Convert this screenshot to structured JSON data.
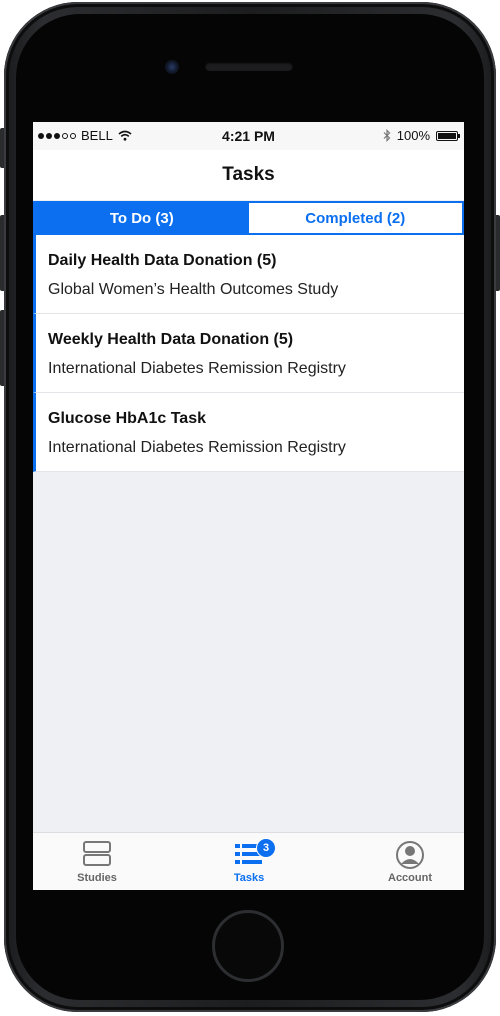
{
  "status_bar": {
    "carrier": "BELL",
    "time": "4:21 PM",
    "battery": "100%"
  },
  "nav": {
    "title": "Tasks"
  },
  "segment": {
    "todo_label": "To Do  (3)",
    "completed_label": "Completed (2)"
  },
  "tasks": [
    {
      "title": "Daily Health Data Donation (5)",
      "study": "Global Women’s Health Outcomes Study"
    },
    {
      "title": "Weekly Health Data Donation (5)",
      "study": "International Diabetes Remission Registry"
    },
    {
      "title": "Glucose HbA1c Task",
      "study": "International Diabetes Remission Registry"
    }
  ],
  "tab_bar": {
    "studies_label": "Studies",
    "tasks_label": "Tasks",
    "tasks_badge": "3",
    "account_label": "Account"
  },
  "colors": {
    "accent": "#0b6ff0",
    "background": "#eef0f3"
  },
  "icons": {
    "studies": "studies-icon",
    "tasks": "tasks-list-icon",
    "account": "account-icon",
    "wifi": "wifi-icon",
    "bluetooth": "bluetooth-icon",
    "battery": "battery-icon"
  }
}
